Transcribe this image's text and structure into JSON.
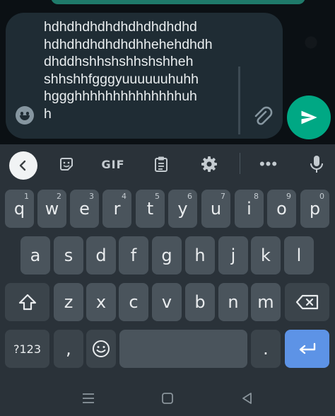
{
  "compose": {
    "text_lines": [
      "hdhdhdhdhdhdhdhdhdhd",
      "hdhdhdhdhdhdhhehehdhdh",
      "dhddhshhshshhshshheh",
      "shhshhfgggyuuuuuuhuhh",
      "hggghhhhhhhhhhhhhhuh",
      "h"
    ]
  },
  "icons": {
    "emoji": "emoji-icon",
    "attach": "paperclip-icon",
    "send": "send-icon",
    "back": "chevron-left-icon",
    "sticker": "sticker-icon",
    "clipboard": "clipboard-icon",
    "settings": "gear-icon",
    "more": "more-icon",
    "mic": "microphone-icon",
    "shift": "shift-icon",
    "backspace": "backspace-icon",
    "enter": "enter-icon",
    "nav_recent": "recent-apps-icon",
    "nav_home": "home-icon",
    "nav_back": "back-triangle-icon"
  },
  "keyboard": {
    "toolbar": {
      "gif_label": "GIF",
      "more_label": "•••"
    },
    "row1": [
      {
        "label": "q",
        "hint": "1"
      },
      {
        "label": "w",
        "hint": "2"
      },
      {
        "label": "e",
        "hint": "3"
      },
      {
        "label": "r",
        "hint": "4"
      },
      {
        "label": "t",
        "hint": "5"
      },
      {
        "label": "y",
        "hint": "6"
      },
      {
        "label": "u",
        "hint": "7"
      },
      {
        "label": "i",
        "hint": "8"
      },
      {
        "label": "o",
        "hint": "9"
      },
      {
        "label": "p",
        "hint": "0"
      }
    ],
    "row2": [
      "a",
      "s",
      "d",
      "f",
      "g",
      "h",
      "j",
      "k",
      "l"
    ],
    "row3": [
      "z",
      "x",
      "c",
      "v",
      "b",
      "n",
      "m"
    ],
    "symbols_label": "?123",
    "comma_label": ",",
    "period_label": "."
  },
  "colors": {
    "accent_send": "#00a884",
    "enter_key": "#5d93e6",
    "key_bg": "#4a545c",
    "keyboard_bg": "#2a3239"
  }
}
